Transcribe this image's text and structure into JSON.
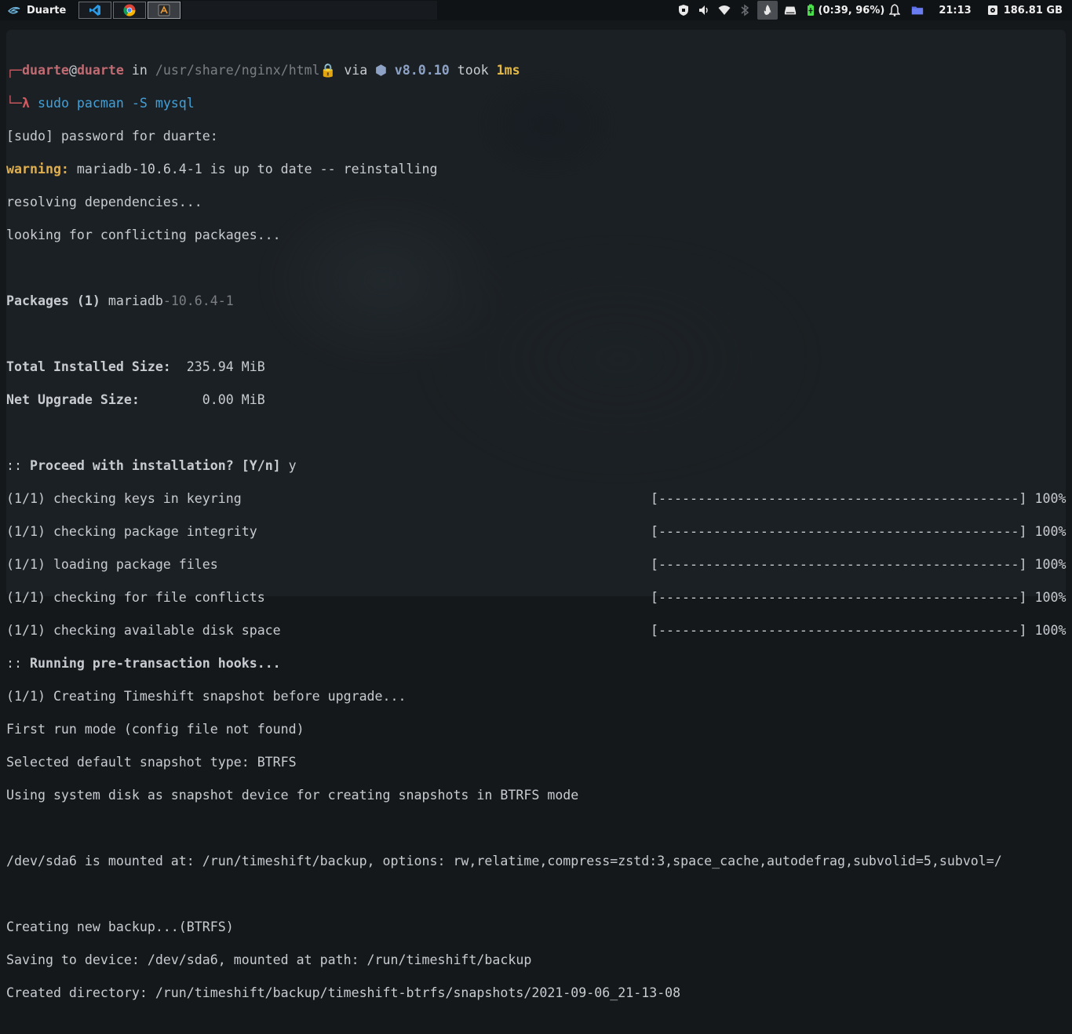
{
  "topbar": {
    "workspace": "Duarte",
    "apps": [
      {
        "name": "vscode",
        "icon": "vscode-icon"
      },
      {
        "name": "chrome",
        "icon": "chrome-icon"
      },
      {
        "name": "terminal",
        "icon": "terminal-app-icon"
      }
    ],
    "battery": "(0:39, 96%)",
    "clock": "21:13",
    "disk": "186.81 GB"
  },
  "terminal": {
    "prompt": {
      "corner": "┌─",
      "user": "duarte",
      "at": "@",
      "host": "duarte",
      "in_text": " in ",
      "path": "/usr/share/nginx/html",
      "lock": "🔒",
      "via": " via ",
      "node_icon": "⬢",
      "version": "v8.0.10",
      "took": " took ",
      "duration": "1ms",
      "corner2": "└─",
      "lambda": "λ",
      "command": " sudo pacman -S mysql"
    },
    "sudo_line": "[sudo] password for duarte:",
    "warning_label": "warning:",
    "warning_text": " mariadb-10.6.4-1 is up to date -- reinstalling",
    "resolving": "resolving dependencies...",
    "conflicts": "looking for conflicting packages...",
    "packages_label": "Packages (1)",
    "package_name": " mariadb",
    "package_version": "-10.6.4-1",
    "total_label": "Total Installed Size:",
    "total_value": "  235.94 MiB",
    "net_label": "Net Upgrade Size:",
    "net_value": "        0.00 MiB",
    "proceed_prefix": ":: ",
    "proceed_text": "Proceed with installation? [Y/n]",
    "proceed_answer": " y",
    "progress_bar": "[----------------------------------------------]",
    "progress_pct": " 100%",
    "steps": [
      "(1/1) checking keys in keyring",
      "(1/1) checking package integrity",
      "(1/1) loading package files",
      "(1/1) checking for file conflicts",
      "(1/1) checking available disk space"
    ],
    "hooks_prefix": ":: ",
    "hooks_text": "Running pre-transaction hooks...",
    "output_lines": [
      "(1/1) Creating Timeshift snapshot before upgrade...",
      "First run mode (config file not found)",
      "Selected default snapshot type: BTRFS",
      "Using system disk as snapshot device for creating snapshots in BTRFS mode"
    ],
    "mount_line": "/dev/sda6 is mounted at: /run/timeshift/backup, options: rw,relatime,compress=zstd:3,space_cache,autodefrag,subvolid=5,subvol=/",
    "final_lines": [
      "Creating new backup...(BTRFS)",
      "Saving to device: /dev/sda6, mounted at path: /run/timeshift/backup",
      "Created directory: /run/timeshift/backup/timeshift-btrfs/snapshots/2021-09-06_21-13-08"
    ]
  }
}
